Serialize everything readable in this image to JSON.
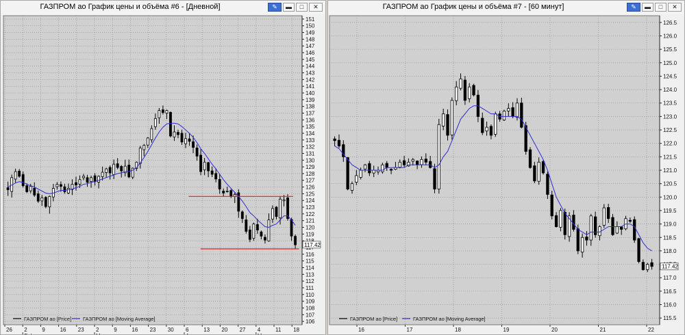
{
  "windows": {
    "left": {
      "title": "ГАЗПРОМ ао График цены и объёма #6 - [Дневной]",
      "buttons": {
        "pin": "pin-icon",
        "minimize": "minimize-icon",
        "maximize": "maximize-icon",
        "close": "close-icon"
      }
    },
    "right": {
      "title": "ГАЗПРОМ ао График цены и объёма #7 - [60 минут]",
      "buttons": {
        "pin": "pin-icon",
        "minimize": "minimize-icon",
        "maximize": "maximize-icon",
        "close": "close-icon"
      }
    }
  },
  "chart_data": [
    {
      "type": "candlestick",
      "panel": "left",
      "timeframe": "Дневной",
      "ylim": [
        105.5,
        151.5
      ],
      "y_ticks": [
        106,
        107,
        108,
        109,
        110,
        111,
        112,
        113,
        114,
        115,
        116,
        117,
        118,
        119,
        120,
        121,
        122,
        123,
        124,
        125,
        126,
        127,
        128,
        129,
        130,
        131,
        132,
        133,
        134,
        135,
        136,
        137,
        138,
        139,
        140,
        141,
        142,
        143,
        144,
        145,
        146,
        147,
        148,
        149,
        150,
        151
      ],
      "x_ticks": [
        "26",
        "2",
        "9",
        "16",
        "23",
        "2",
        "9",
        "16",
        "23",
        "30",
        "6",
        "13",
        "20",
        "27",
        "4",
        "11",
        "18"
      ],
      "month_labels": [
        "Feb",
        "Mar",
        "Apr",
        "May"
      ],
      "last_price": "117.42",
      "grid": true,
      "legend": {
        "placement": "bottom-left",
        "entries": [
          {
            "name": "ГАЗПРОМ ао [Price]",
            "color": "#000000"
          },
          {
            "name": "ГАЗПРОМ ао [Moving Average]",
            "color": "#2d2dd4"
          }
        ]
      },
      "horizontal_lines": [
        {
          "y": 124.6,
          "color": "#e02020"
        },
        {
          "y": 116.8,
          "color": "#e02020"
        }
      ],
      "close": [
        125.6,
        127.4,
        128.3,
        127.6,
        126.2,
        125.3,
        126.1,
        124.8,
        123.9,
        124.4,
        123.1,
        124.6,
        125.8,
        126.4,
        126.1,
        125.3,
        125.8,
        126.4,
        126.3,
        127.1,
        127.6,
        126.7,
        127.4,
        126.8,
        127.6,
        128.2,
        128.7,
        128.1,
        129.4,
        128.9,
        128.4,
        129.1,
        127.5,
        128.8,
        129.7,
        131.8,
        132.2,
        133.3,
        134.7,
        136.2,
        137.4,
        137.1,
        137.4,
        133.6,
        134.2,
        133.8,
        132.7,
        133.2,
        132.8,
        131.9,
        130.6,
        128.3,
        129.7,
        128.4,
        127.9,
        127.2,
        125.7,
        125.1,
        125.4,
        124.6,
        124.9,
        122.4,
        121.3,
        119.4,
        118.2,
        120.5,
        119.6,
        118.7,
        118.1,
        121.1,
        122.8,
        121.6,
        124.2,
        124.1,
        121.3,
        118.7,
        117.4
      ],
      "ma": [
        126.0,
        126.3,
        126.6,
        126.8,
        126.7,
        126.4,
        126.2,
        126.0,
        125.7,
        125.4,
        125.1,
        125.0,
        125.1,
        125.3,
        125.5,
        125.5,
        125.6,
        125.7,
        125.9,
        126.1,
        126.4,
        126.5,
        126.7,
        126.8,
        127.0,
        127.2,
        127.4,
        127.6,
        127.8,
        128.0,
        128.1,
        128.3,
        128.3,
        128.5,
        128.9,
        129.6,
        130.4,
        131.3,
        132.3,
        133.3,
        134.2,
        134.9,
        135.4,
        135.5,
        135.5,
        135.4,
        135.0,
        134.5,
        134.0,
        133.4,
        132.6,
        131.7,
        131.0,
        130.2,
        129.4,
        128.7,
        127.9,
        127.1,
        126.4,
        125.8,
        125.2,
        124.6,
        123.9,
        123.1,
        122.2,
        121.7,
        121.1,
        120.6,
        120.1,
        120.0,
        120.3,
        120.5,
        121.1,
        121.7,
        121.7,
        121.1,
        120.3
      ]
    },
    {
      "type": "candlestick",
      "panel": "right",
      "timeframe": "60 минут",
      "ylim": [
        115.25,
        126.75
      ],
      "y_ticks": [
        115.5,
        116.0,
        116.5,
        117.0,
        117.5,
        118.0,
        118.5,
        119.0,
        119.5,
        120.0,
        120.5,
        121.0,
        121.5,
        122.0,
        122.5,
        123.0,
        123.5,
        124.0,
        124.5,
        125.0,
        125.5,
        126.0,
        126.5
      ],
      "x_ticks": [
        "16",
        "17",
        "18",
        "19",
        "20",
        "21",
        "22"
      ],
      "last_price": "117.42",
      "grid": true,
      "legend": {
        "placement": "bottom-left",
        "entries": [
          {
            "name": "ГАЗПРОМ ао [Price]",
            "color": "#000000"
          },
          {
            "name": "ГАЗПРОМ ао [Moving Average]",
            "color": "#2d2dd4"
          }
        ]
      },
      "close": [
        122.1,
        121.9,
        121.5,
        120.3,
        120.5,
        120.8,
        121.0,
        121.2,
        120.9,
        121.0,
        121.0,
        121.2,
        121.1,
        121.0,
        121.1,
        121.3,
        121.2,
        121.3,
        121.4,
        121.2,
        121.4,
        121.3,
        121.1,
        120.3,
        122.7,
        123.1,
        122.3,
        123.6,
        124.1,
        124.4,
        123.6,
        124.1,
        123.8,
        123.0,
        122.4,
        122.6,
        122.3,
        123.1,
        122.9,
        123.2,
        123.3,
        123.0,
        123.5,
        122.6,
        121.7,
        121.1,
        120.6,
        121.3,
        120.9,
        120.1,
        119.3,
        118.9,
        119.5,
        118.6,
        119.3,
        118.8,
        118.0,
        118.5,
        118.4,
        119.3,
        118.6,
        118.9,
        119.6,
        119.2,
        118.6,
        118.9,
        118.8,
        119.2,
        119.1,
        118.4,
        117.6,
        117.3,
        117.5,
        117.42
      ],
      "ma": [
        121.9,
        121.8,
        121.6,
        121.4,
        121.2,
        121.1,
        121.0,
        121.0,
        121.0,
        121.0,
        121.0,
        121.0,
        121.1,
        121.1,
        121.1,
        121.1,
        121.1,
        121.2,
        121.2,
        121.2,
        121.2,
        121.2,
        121.2,
        121.1,
        121.2,
        121.5,
        121.7,
        122.1,
        122.5,
        122.9,
        123.1,
        123.3,
        123.4,
        123.4,
        123.3,
        123.2,
        123.1,
        123.1,
        123.0,
        123.0,
        123.0,
        123.0,
        123.0,
        122.9,
        122.6,
        122.3,
        122.0,
        121.7,
        121.4,
        121.0,
        120.5,
        120.0,
        119.7,
        119.4,
        119.2,
        119.0,
        118.8,
        118.7,
        118.6,
        118.7,
        118.7,
        118.7,
        118.8,
        118.9,
        118.9,
        118.9,
        118.9,
        119.0,
        119.0,
        118.9,
        118.6,
        118.3,
        118.1,
        118.0
      ]
    }
  ]
}
